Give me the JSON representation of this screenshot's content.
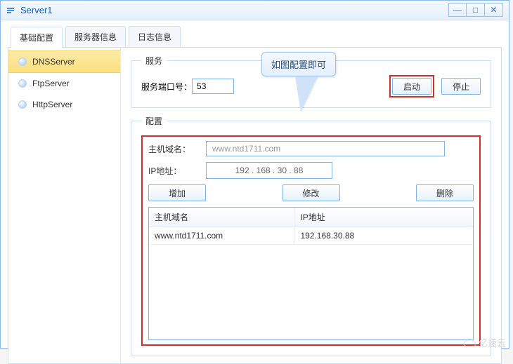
{
  "window": {
    "title": "Server1"
  },
  "tabs": [
    {
      "label": "基础配置"
    },
    {
      "label": "服务器信息"
    },
    {
      "label": "日志信息"
    }
  ],
  "sidebar": {
    "items": [
      {
        "label": "DNSServer"
      },
      {
        "label": "FtpServer"
      },
      {
        "label": "HttpServer"
      }
    ]
  },
  "service": {
    "legend": "服务",
    "port_label": "服务端口号：",
    "port_value": "53",
    "start_label": "启动",
    "stop_label": "停止"
  },
  "config": {
    "legend": "配置",
    "host_label": "主机域名：",
    "host_value": "www.ntd1711.com",
    "ip_label": "IP地址：",
    "ip_value": "192  .  168  .  30  .  88",
    "add_label": "增加",
    "modify_label": "修改",
    "delete_label": "删除",
    "table": {
      "headers": [
        "主机域名",
        "IP地址"
      ],
      "rows": [
        {
          "domain": "www.ntd1711.com",
          "ip": "192.168.30.88"
        }
      ]
    }
  },
  "callout": {
    "text": "如图配置即可"
  },
  "watermark": "亿速云"
}
